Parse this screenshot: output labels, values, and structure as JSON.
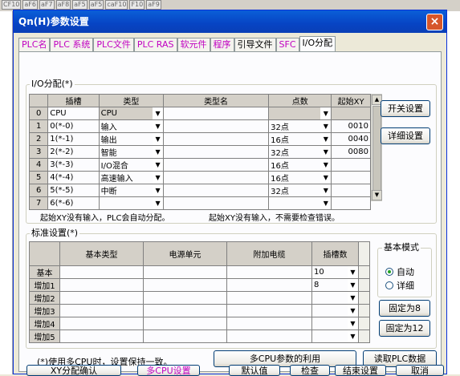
{
  "bg_strip": [
    "CF10",
    "aF6",
    "aF7",
    "aF8",
    "aF5",
    "aF5",
    "caF10",
    "F10",
    "aF9"
  ],
  "window": {
    "title": "Qn(H)参数设置",
    "close": "×"
  },
  "tabs": [
    {
      "label": "PLC名",
      "style": "magenta"
    },
    {
      "label": "PLC 系统",
      "style": "magenta"
    },
    {
      "label": "PLC文件",
      "style": "magenta"
    },
    {
      "label": "PLC RAS",
      "style": "magenta"
    },
    {
      "label": "软元件",
      "style": "magenta"
    },
    {
      "label": "程序",
      "style": "magenta"
    },
    {
      "label": "引导文件",
      "style": "black"
    },
    {
      "label": "SFC",
      "style": "magenta"
    },
    {
      "label": "I/O分配",
      "style": "active"
    }
  ],
  "io": {
    "group_title": "I/O分配(*)",
    "headers": [
      "插槽",
      "类型",
      "类型名",
      "点数",
      "起始XY"
    ],
    "rows": [
      {
        "idx": "0",
        "slot": "CPU",
        "type": "CPU",
        "name": "",
        "points": "",
        "start": ""
      },
      {
        "idx": "1",
        "slot": "0(*-0)",
        "type": "输入",
        "name": "",
        "points": "32点",
        "start": "0010"
      },
      {
        "idx": "2",
        "slot": "1(*-1)",
        "type": "输出",
        "name": "",
        "points": "16点",
        "start": "0040"
      },
      {
        "idx": "3",
        "slot": "2(*-2)",
        "type": "智能",
        "name": "",
        "points": "32点",
        "start": "0080"
      },
      {
        "idx": "4",
        "slot": "3(*-3)",
        "type": "I/O混合",
        "name": "",
        "points": "16点",
        "start": ""
      },
      {
        "idx": "5",
        "slot": "4(*-4)",
        "type": "高速输入",
        "name": "",
        "points": "16点",
        "start": ""
      },
      {
        "idx": "6",
        "slot": "5(*-5)",
        "type": "中断",
        "name": "",
        "points": "32点",
        "start": ""
      },
      {
        "idx": "7",
        "slot": "6(*-6)",
        "type": "",
        "name": "",
        "points": "",
        "start": ""
      }
    ],
    "note1": "起始XY没有输入，PLC会自动分配。",
    "note2": "起始XY没有输入，不需要检查错误。",
    "btn_switch": "开关设置",
    "btn_detail": "详细设置"
  },
  "std": {
    "group_title": "标准设置(*)",
    "headers": [
      "基本类型",
      "电源单元",
      "附加电缆",
      "插槽数"
    ],
    "rows": [
      {
        "label": "基本",
        "slots": "10"
      },
      {
        "label": "增加1",
        "slots": "8"
      },
      {
        "label": "增加2",
        "slots": ""
      },
      {
        "label": "增加3",
        "slots": ""
      },
      {
        "label": "增加4",
        "slots": ""
      },
      {
        "label": "增加5",
        "slots": ""
      }
    ],
    "mode_title": "基本模式",
    "mode_auto": "自动",
    "mode_detail": "详细",
    "btn_fix8": "固定为8",
    "btn_fix12": "固定为12"
  },
  "footer_note": "(*)使用多CPU时，设置保持一致。",
  "btn_multi_cpu_use": "多CPU参数的利用",
  "btn_read_plc": "读取PLC数据",
  "bottom_buttons": [
    "XY分配确认",
    "多CPU设置",
    "默认值",
    "检查",
    "结束设置",
    "取消"
  ],
  "colors": {
    "title_bar": "#0a5fd8",
    "tab_text": "#c000c0",
    "multi_cpu": "#c000c0"
  }
}
